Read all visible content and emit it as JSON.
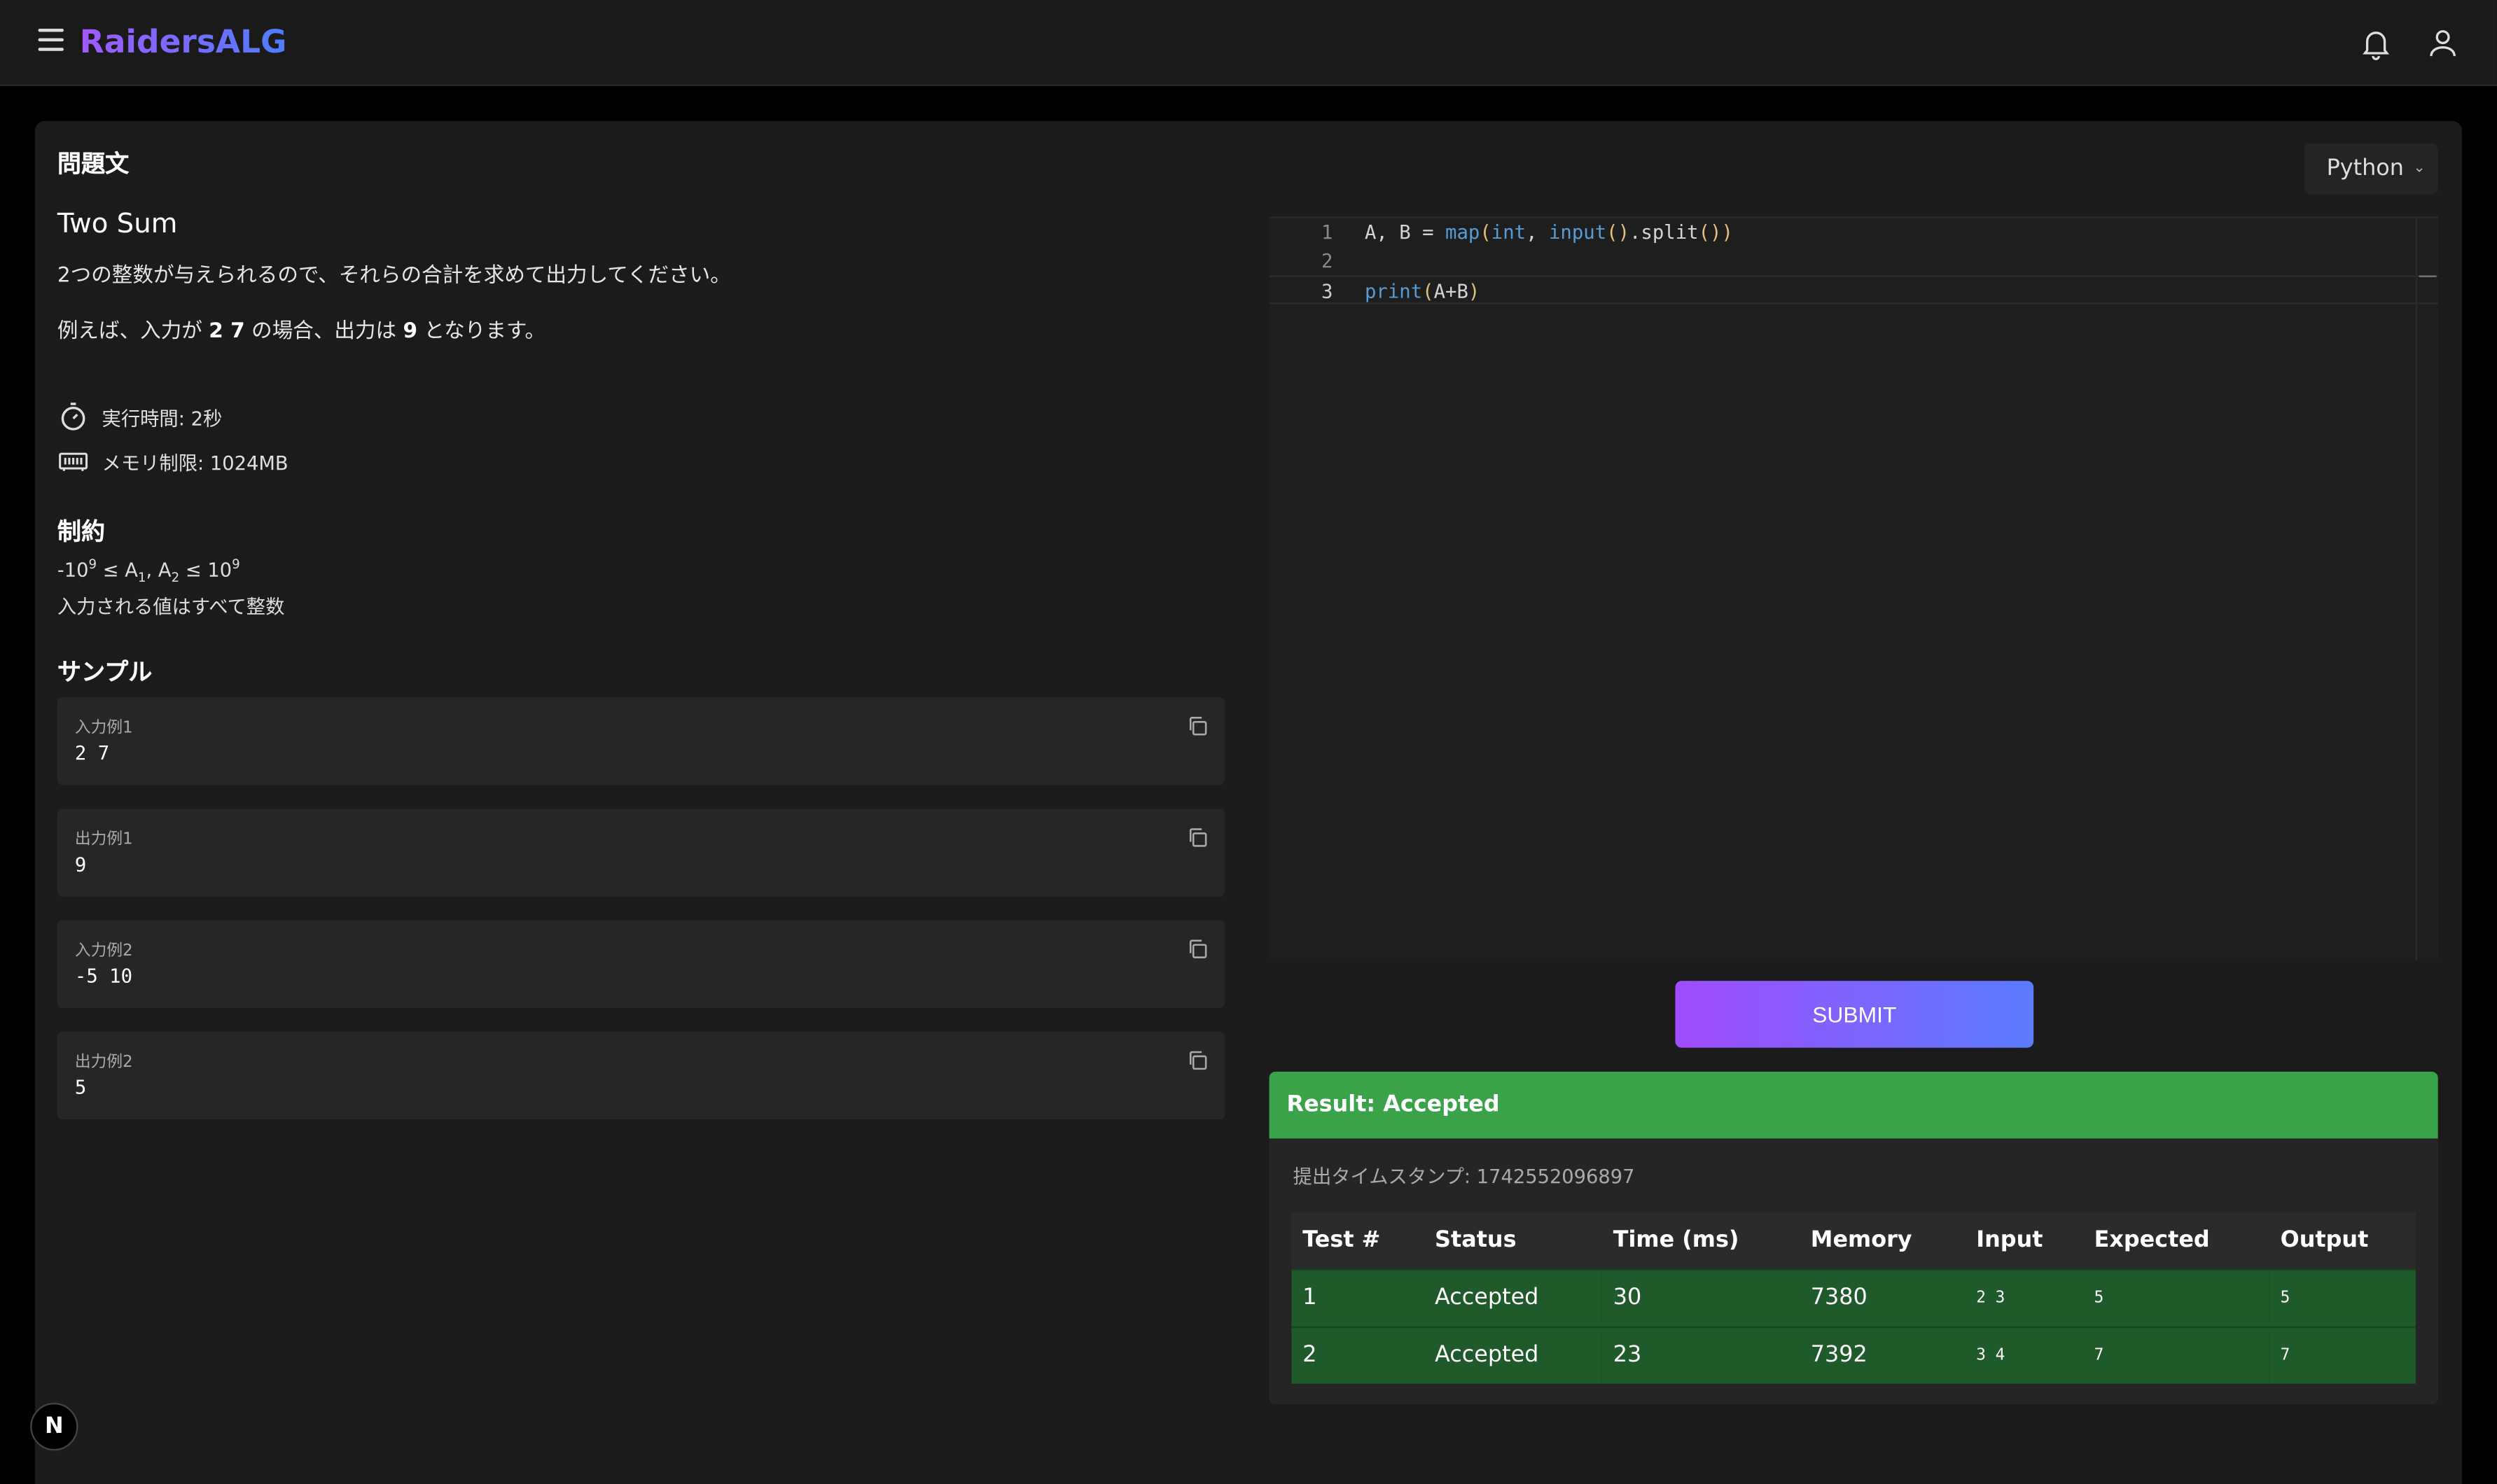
{
  "header": {
    "brand": "RaidersALG"
  },
  "problem": {
    "section_label": "問題文",
    "title": "Two Sum",
    "description": "2つの整数が与えられるので、それらの合計を求めて出力してください。",
    "example_prefix": "例えば、入力が",
    "example_input": "2 7",
    "example_mid": "の場合、出力は",
    "example_output": "9",
    "example_suffix": "となります。",
    "time_limit": "実行時間: 2秒",
    "memory_limit": "メモリ制限: 1024MB",
    "constraints_label": "制約",
    "constraint_line1": {
      "part1": "-10",
      "sup1": "9",
      "part2": " ≤ A",
      "sub1": "1",
      "part3": ", A",
      "sub2": "2",
      "part4": " ≤ 10",
      "sup2": "9"
    },
    "constraint_line2": "入力される値はすべて整数",
    "samples_label": "サンプル",
    "samples": [
      {
        "label": "入力例1",
        "value": "2 7"
      },
      {
        "label": "出力例1",
        "value": "9"
      },
      {
        "label": "入力例2",
        "value": "-5 10"
      },
      {
        "label": "出力例2",
        "value": "5"
      }
    ]
  },
  "editor": {
    "language": "Python",
    "line_numbers": [
      "1",
      "2",
      "3"
    ],
    "line1": {
      "a": "A, B = ",
      "map": "map",
      "p1": "(",
      "int": "int",
      "comma": ", ",
      "input": "input",
      "p2": "()",
      "split": ".split",
      "p3": "())"
    },
    "line3": {
      "print": "print",
      "p1": "(",
      "args": "A+B",
      "p2": ")"
    }
  },
  "submit_label": "SUBMIT",
  "result": {
    "title": "Result: Accepted",
    "timestamp": "提出タイムスタンプ: 1742552096897",
    "columns": [
      "Test #",
      "Status",
      "Time (ms)",
      "Memory",
      "Input",
      "Expected",
      "Output"
    ],
    "rows": [
      {
        "test": "1",
        "status": "Accepted",
        "time": "30",
        "memory": "7380",
        "input": "2 3",
        "expected": "5",
        "output": "5"
      },
      {
        "test": "2",
        "status": "Accepted",
        "time": "23",
        "memory": "7392",
        "input": "3 4",
        "expected": "7",
        "output": "7"
      }
    ]
  },
  "dev_badge": "N",
  "colors": {
    "brand_gradient_start": "#a259ff",
    "brand_gradient_end": "#4f7cff",
    "accepted_green": "#3aa34a",
    "row_green": "#1f5a2a"
  }
}
